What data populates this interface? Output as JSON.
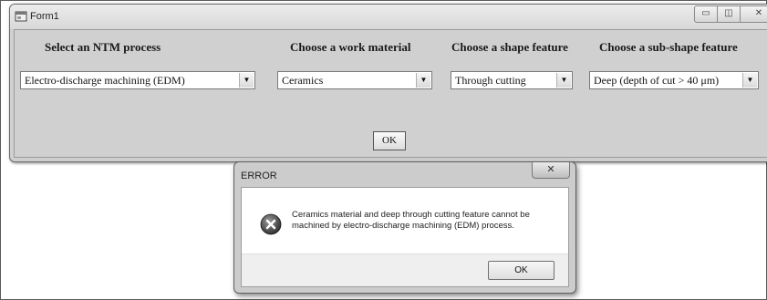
{
  "form": {
    "title": "Form1",
    "window_buttons": {
      "minimize": "▭",
      "maximize": "◫",
      "close": "✕"
    },
    "labels": {
      "process": "Select an NTM process",
      "material": "Choose a work material",
      "shape": "Choose a shape feature",
      "subshape": "Choose a sub-shape feature"
    },
    "combos": {
      "process": "Electro-discharge machining (EDM)",
      "material": "Ceramics",
      "shape": "Through cutting",
      "subshape": "Deep (depth of cut > 40 μm)"
    },
    "ok_label": "OK"
  },
  "dialog": {
    "title": "ERROR",
    "close_label": "✕",
    "message": "Ceramics material and deep through cutting feature cannot be machined by electro-discharge machining (EDM) process.",
    "ok_label": "OK",
    "icon": "error-x-icon"
  }
}
